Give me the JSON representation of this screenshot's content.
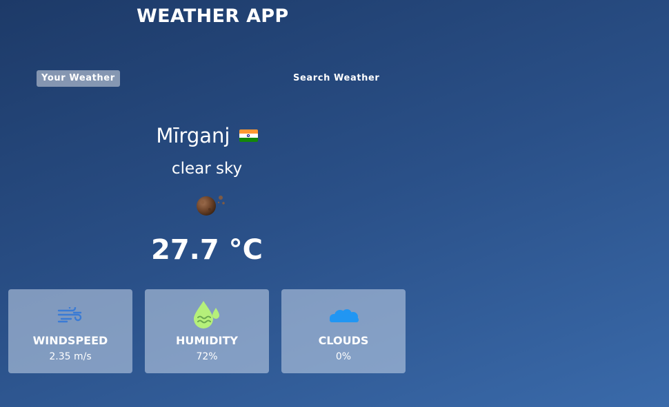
{
  "app": {
    "title": "WEATHER APP"
  },
  "tabs": [
    {
      "label": "Your Weather",
      "active": true
    },
    {
      "label": "Search Weather",
      "active": false
    }
  ],
  "weather": {
    "city": "Mīrganj",
    "country_flag": "india-flag-icon",
    "description": "clear sky",
    "condition_icon": "clear-sky-icon",
    "temperature": "27.7 °C"
  },
  "stats": [
    {
      "label": "WINDSPEED",
      "value": "2.35 m/s",
      "icon": "wind-icon",
      "icon_color": "#3a7bd5"
    },
    {
      "label": "HUMIDITY",
      "value": "72%",
      "icon": "humidity-icon",
      "icon_color": "#b5f07a"
    },
    {
      "label": "CLOUDS",
      "value": "0%",
      "icon": "cloud-icon",
      "icon_color": "#2196f3"
    }
  ],
  "colors": {
    "background_top": "#1d3a68",
    "background_bottom": "#3a6aaa",
    "text": "#ffffff"
  }
}
